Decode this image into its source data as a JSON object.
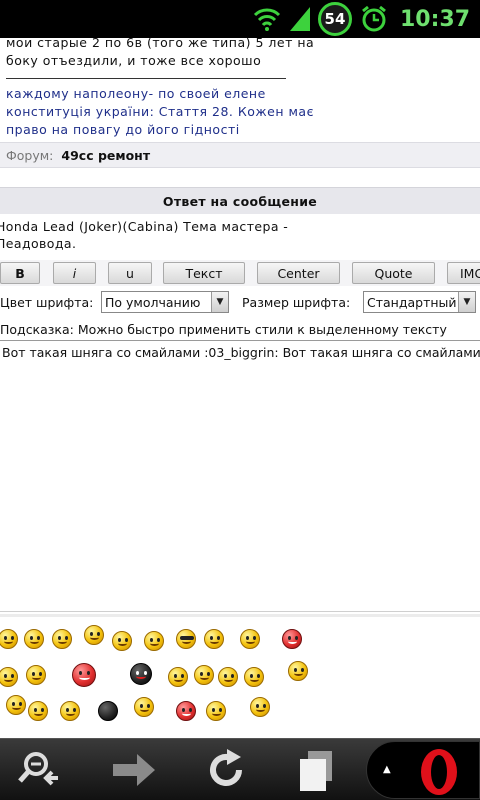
{
  "status_bar": {
    "battery": "54",
    "time": "10:37",
    "icons": [
      "wifi-icon",
      "signal-icon",
      "battery-icon",
      "alarm-icon"
    ]
  },
  "post": {
    "lines": [
      "мои старые 2 по 6в (того же типа) 5 лет на",
      "боку отъездили, и тоже все хорошо"
    ],
    "signature": [
      "каждому наполеону- по своей елене",
      "конституція україни: Стаття 28. Кожен має",
      "право на повагу до його гідності"
    ]
  },
  "forum": {
    "label": "Форум:",
    "name": "49cc ремонт"
  },
  "reply": {
    "title": "Ответ на сообщение"
  },
  "topic": {
    "line1": "Honda Lead (Joker)(Cabina)  Тема мастера -",
    "line2": "Леадовода."
  },
  "toolbar": {
    "buttons": [
      "B",
      "i",
      "u",
      "Текст",
      "Center",
      "Quote",
      "IMG"
    ]
  },
  "font": {
    "color_label": "Цвет шрифта:",
    "color_value": "По умолчанию",
    "size_label": "Размер шрифта:",
    "size_value": "Стандартный"
  },
  "hint": "Подсказка: Можно быстро применить стили к выделенному тексту",
  "message": "Вот такая шняга со смайлами :03_biggrin: Вот такая шняга со смайлами",
  "nav": [
    "zoom-out-icon",
    "forward-icon",
    "reload-icon",
    "tabs-icon",
    "opera-menu-icon"
  ],
  "colors": {
    "signature": "#1f2f8a",
    "status_green": "#3dd23d",
    "opera_red": "#e0101a"
  }
}
